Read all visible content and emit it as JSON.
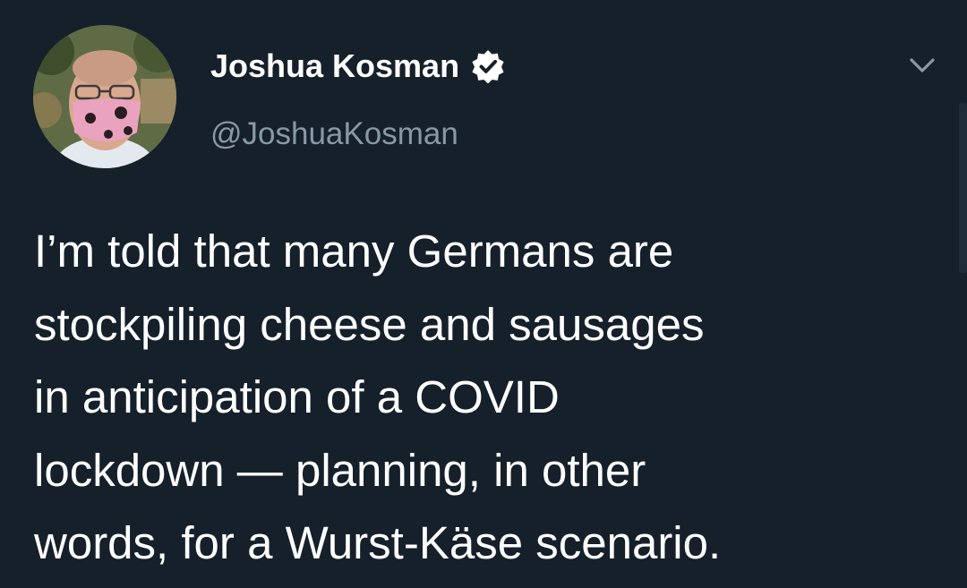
{
  "tweet": {
    "author_name": "Joshua Kosman",
    "handle": "@JoshuaKosman",
    "text_lines": [
      "I’m told that many Germans are",
      "stockpiling cheese and sausages",
      "in anticipation of a COVID",
      "lockdown — planning, in other",
      "words, for a Wurst-Käse scenario."
    ]
  },
  "icons": {
    "verified": "verified-badge-icon",
    "menu": "chevron-down-icon"
  },
  "colors": {
    "background": "#15202b",
    "name": "#ffffff",
    "handle": "#8899a6",
    "text": "#ffffff"
  }
}
